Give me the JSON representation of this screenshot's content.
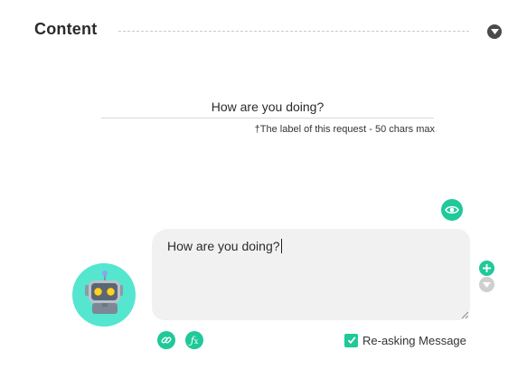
{
  "section": {
    "title": "Content"
  },
  "request_label": {
    "value": "How are you doing?",
    "hint": "†The label of this request - 50 chars max"
  },
  "message": {
    "text": "How are you doing?"
  },
  "options": {
    "reask_label": "Re-asking Message",
    "reask_checked": true
  },
  "colors": {
    "accent": "#1fc99a",
    "avatar_bg": "#54e6cf",
    "bubble_bg": "#f1f1f1"
  },
  "icons": {
    "collapse": "chevron-down-icon",
    "preview": "eye-icon",
    "avatar": "robot-icon",
    "add": "plus-icon",
    "move_down": "arrow-down-icon",
    "link": "link-icon",
    "function": "fx-icon",
    "checkbox": "check-icon"
  }
}
